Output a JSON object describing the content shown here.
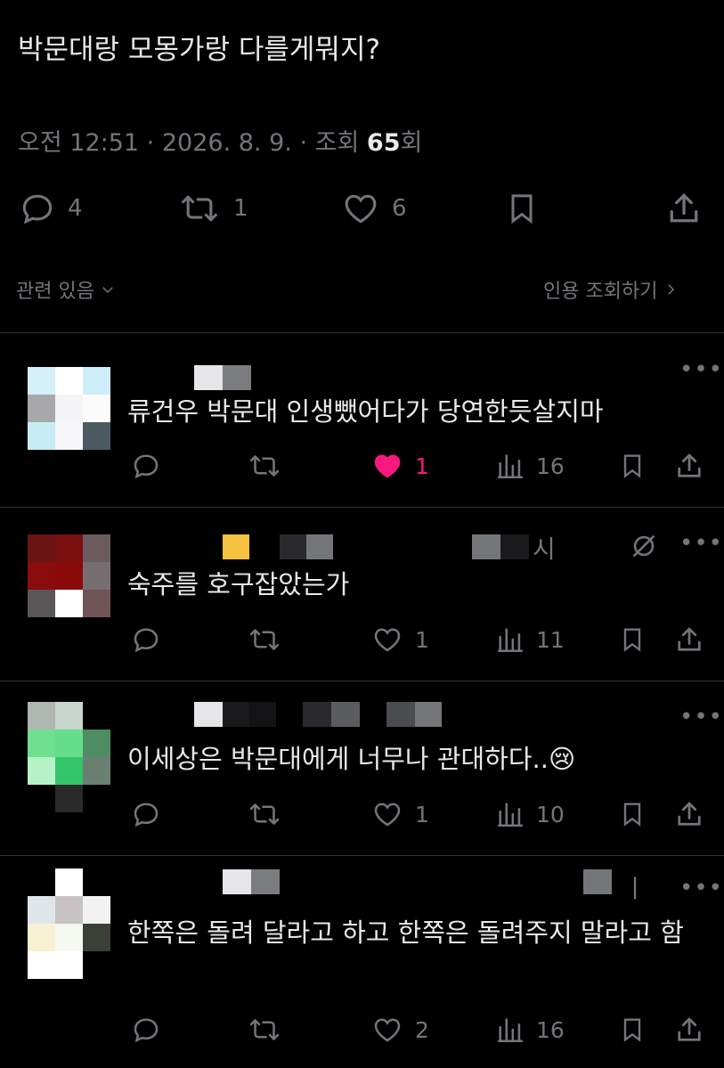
{
  "post": {
    "text": "박문대랑 모몽가랑 다를게뭐지?",
    "time": "오전 12:51",
    "sep1": "·",
    "date": "2026. 8. 9.",
    "sep2": "·",
    "views_label": "조회",
    "views_count": "65",
    "views_suffix": "회",
    "stats": {
      "replies": "4",
      "reposts": "1",
      "likes": "6"
    }
  },
  "filter": {
    "sort_label": "관련 있음",
    "quote_label": "인용 조회하기"
  },
  "replies": [
    {
      "text": "류건우 박문대 인생뺐어다가 당연한듯살지마",
      "replies": "",
      "reposts": "",
      "likes": "1",
      "views": "16",
      "liked": true
    },
    {
      "text": "숙주를 호구잡았는가",
      "replies": "",
      "reposts": "",
      "likes": "1",
      "views": "11",
      "liked": false,
      "name_tail": "시"
    },
    {
      "text": "이세상은 박문대에게 너무나 관대하다..😢",
      "replies": "",
      "reposts": "",
      "likes": "1",
      "views": "10",
      "liked": false
    },
    {
      "text": "한쪽은 돌려 달라고 하고 한쪽은 돌려주지 말라고 함",
      "replies": "",
      "reposts": "",
      "likes": "2",
      "views": "16",
      "liked": false,
      "name_tail": "ㅣ"
    }
  ],
  "icons": [
    "reply-icon",
    "repost-icon",
    "like-icon",
    "bookmark-icon",
    "share-icon",
    "views-icon",
    "more-icon",
    "chevron-down-icon",
    "chevron-right-icon",
    "grok-icon"
  ],
  "colors": {
    "background": "#000000",
    "text": "#e7e9ea",
    "muted": "#71767b",
    "like": "#f91880",
    "divider": "#2f3336"
  }
}
